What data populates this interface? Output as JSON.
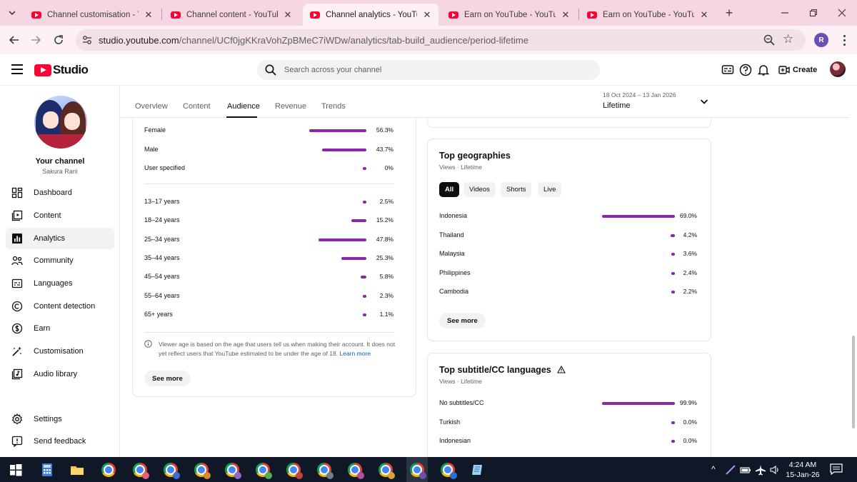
{
  "browser": {
    "tabs": [
      {
        "title": "Channel customisation - YouTube",
        "active": false
      },
      {
        "title": "Channel content - YouTube Studio",
        "active": false
      },
      {
        "title": "Channel analytics - YouTube Studio",
        "active": true
      },
      {
        "title": "Earn on YouTube - YouTube Studio",
        "active": false
      },
      {
        "title": "Earn on YouTube - YouTube Studio",
        "active": false
      }
    ],
    "url_host": "studio.youtube.com",
    "url_path": "/channel/UCf0jgKKraVohZpBMeC7iWDw/analytics/tab-build_audience/period-lifetime",
    "profile_initial": "R"
  },
  "header": {
    "logo_text": "Studio",
    "search_placeholder": "Search across your channel",
    "create_label": "Create"
  },
  "sidebar": {
    "channel_label": "Your channel",
    "channel_name": "Sakura Rani",
    "items": [
      {
        "label": "Dashboard",
        "icon": "dashboard-icon"
      },
      {
        "label": "Content",
        "icon": "content-icon"
      },
      {
        "label": "Analytics",
        "icon": "analytics-icon",
        "active": true
      },
      {
        "label": "Community",
        "icon": "community-icon"
      },
      {
        "label": "Languages",
        "icon": "languages-icon"
      },
      {
        "label": "Content detection",
        "icon": "copyright-icon"
      },
      {
        "label": "Earn",
        "icon": "earn-icon"
      },
      {
        "label": "Customisation",
        "icon": "customisation-icon"
      },
      {
        "label": "Audio library",
        "icon": "audio-library-icon"
      }
    ],
    "bottom_items": [
      {
        "label": "Settings",
        "icon": "settings-icon"
      },
      {
        "label": "Send feedback",
        "icon": "feedback-icon"
      }
    ]
  },
  "analytics": {
    "tabs": [
      "Overview",
      "Content",
      "Audience",
      "Revenue",
      "Trends"
    ],
    "active_tab": "Audience",
    "period_range": "18 Oct 2024 – 13 Jan 2026",
    "period_label": "Lifetime"
  },
  "demographics": {
    "gender": [
      {
        "label": "Female",
        "value": "56.3%",
        "pct": 56.3
      },
      {
        "label": "Male",
        "value": "43.7%",
        "pct": 43.7
      },
      {
        "label": "User specified",
        "value": "0%",
        "pct": 0
      }
    ],
    "age": [
      {
        "label": "13–17 years",
        "value": "2.5%",
        "pct": 2.5
      },
      {
        "label": "18–24 years",
        "value": "15.2%",
        "pct": 15.2
      },
      {
        "label": "25–34 years",
        "value": "47.8%",
        "pct": 47.8
      },
      {
        "label": "35–44 years",
        "value": "25.3%",
        "pct": 25.3
      },
      {
        "label": "45–54 years",
        "value": "5.8%",
        "pct": 5.8
      },
      {
        "label": "55–64 years",
        "value": "2.3%",
        "pct": 2.3
      },
      {
        "label": "65+ years",
        "value": "1.1%",
        "pct": 1.1
      }
    ],
    "note": "Viewer age is based on the age that users tell us when making their account. It does not yet reflect users that YouTube estimated to be under the age of 18.",
    "note_link": "Learn more",
    "see_more": "See more"
  },
  "geographies": {
    "title": "Top geographies",
    "subtitle": "Views · Lifetime",
    "chips": [
      "All",
      "Videos",
      "Shorts",
      "Live"
    ],
    "active_chip": "All",
    "rows": [
      {
        "label": "Indonesia",
        "value": "69.0%",
        "pct": 69.0
      },
      {
        "label": "Thailand",
        "value": "4.2%",
        "pct": 4.2
      },
      {
        "label": "Malaysia",
        "value": "3.6%",
        "pct": 3.6
      },
      {
        "label": "Philippines",
        "value": "2.4%",
        "pct": 2.4
      },
      {
        "label": "Cambodia",
        "value": "2.2%",
        "pct": 2.2
      }
    ],
    "see_more": "See more"
  },
  "subtitles": {
    "title": "Top subtitle/CC languages",
    "subtitle": "Views · Lifetime",
    "rows": [
      {
        "label": "No subtitles/CC",
        "value": "99.9%",
        "pct": 99.9
      },
      {
        "label": "Turkish",
        "value": "0.0%",
        "pct": 0.0
      },
      {
        "label": "Indonesian",
        "value": "0.0%",
        "pct": 0.0
      }
    ]
  },
  "taskbar": {
    "time": "4:24 AM",
    "date": "15-Jan-26"
  },
  "colors": {
    "bar": "#8e24aa",
    "youtube_red": "#ff0033",
    "tabstrip": "#f7d6e3"
  }
}
